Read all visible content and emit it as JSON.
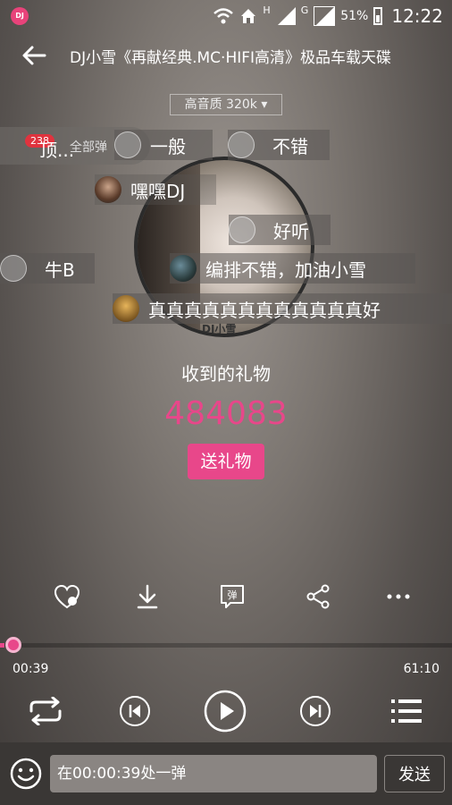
{
  "status_bar": {
    "app_badge": "DJ",
    "network_h": "H",
    "network_g": "G",
    "battery": "51%",
    "time": "12:22"
  },
  "header": {
    "title": "DJ小雪《再献经典.MC·HIFI高清》极品车载天碟",
    "quality": "高音质 320k"
  },
  "danmaku_panel": {
    "count": "238",
    "ding": "顶...",
    "all_label": "全部弹"
  },
  "danmaku": [
    {
      "text": "一般"
    },
    {
      "text": "不错"
    },
    {
      "text": "嘿嘿DJ"
    },
    {
      "text": "好听"
    },
    {
      "text": "牛B"
    },
    {
      "text": "编排不错，加油小雪"
    },
    {
      "text": "真真真真真真真真真真真真好"
    }
  ],
  "album": {
    "caption": "DJ小雪"
  },
  "gifts": {
    "label": "收到的礼物",
    "count": "484083",
    "button": "送礼物"
  },
  "actions": {
    "danmaku_icon_char": "弹"
  },
  "player": {
    "current_time": "00:39",
    "total_time": "61:10",
    "progress": 0.0106
  },
  "input": {
    "placeholder": "在00:00:39处一弹",
    "send": "发送"
  },
  "colors": {
    "accent": "#e8478a",
    "badge_red": "#e0333e"
  }
}
